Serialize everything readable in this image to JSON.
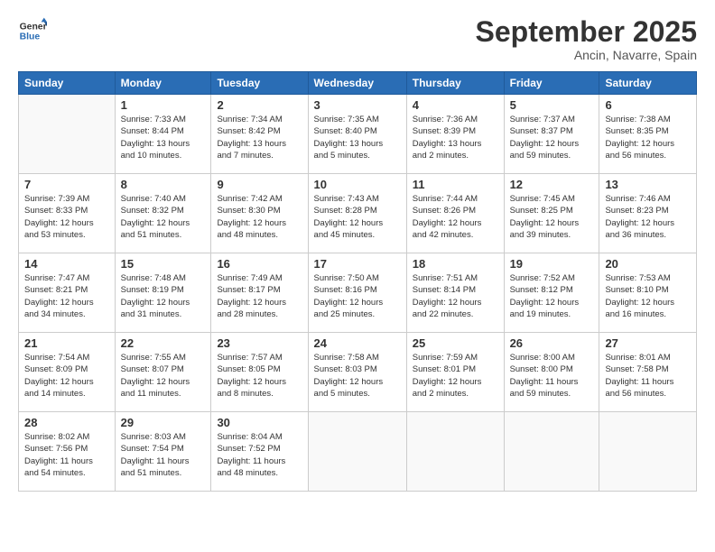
{
  "logo": {
    "line1": "General",
    "line2": "Blue"
  },
  "title": "September 2025",
  "subtitle": "Ancin, Navarre, Spain",
  "headers": [
    "Sunday",
    "Monday",
    "Tuesday",
    "Wednesday",
    "Thursday",
    "Friday",
    "Saturday"
  ],
  "weeks": [
    [
      {
        "day": "",
        "info": ""
      },
      {
        "day": "1",
        "info": "Sunrise: 7:33 AM\nSunset: 8:44 PM\nDaylight: 13 hours\nand 10 minutes."
      },
      {
        "day": "2",
        "info": "Sunrise: 7:34 AM\nSunset: 8:42 PM\nDaylight: 13 hours\nand 7 minutes."
      },
      {
        "day": "3",
        "info": "Sunrise: 7:35 AM\nSunset: 8:40 PM\nDaylight: 13 hours\nand 5 minutes."
      },
      {
        "day": "4",
        "info": "Sunrise: 7:36 AM\nSunset: 8:39 PM\nDaylight: 13 hours\nand 2 minutes."
      },
      {
        "day": "5",
        "info": "Sunrise: 7:37 AM\nSunset: 8:37 PM\nDaylight: 12 hours\nand 59 minutes."
      },
      {
        "day": "6",
        "info": "Sunrise: 7:38 AM\nSunset: 8:35 PM\nDaylight: 12 hours\nand 56 minutes."
      }
    ],
    [
      {
        "day": "7",
        "info": "Sunrise: 7:39 AM\nSunset: 8:33 PM\nDaylight: 12 hours\nand 53 minutes."
      },
      {
        "day": "8",
        "info": "Sunrise: 7:40 AM\nSunset: 8:32 PM\nDaylight: 12 hours\nand 51 minutes."
      },
      {
        "day": "9",
        "info": "Sunrise: 7:42 AM\nSunset: 8:30 PM\nDaylight: 12 hours\nand 48 minutes."
      },
      {
        "day": "10",
        "info": "Sunrise: 7:43 AM\nSunset: 8:28 PM\nDaylight: 12 hours\nand 45 minutes."
      },
      {
        "day": "11",
        "info": "Sunrise: 7:44 AM\nSunset: 8:26 PM\nDaylight: 12 hours\nand 42 minutes."
      },
      {
        "day": "12",
        "info": "Sunrise: 7:45 AM\nSunset: 8:25 PM\nDaylight: 12 hours\nand 39 minutes."
      },
      {
        "day": "13",
        "info": "Sunrise: 7:46 AM\nSunset: 8:23 PM\nDaylight: 12 hours\nand 36 minutes."
      }
    ],
    [
      {
        "day": "14",
        "info": "Sunrise: 7:47 AM\nSunset: 8:21 PM\nDaylight: 12 hours\nand 34 minutes."
      },
      {
        "day": "15",
        "info": "Sunrise: 7:48 AM\nSunset: 8:19 PM\nDaylight: 12 hours\nand 31 minutes."
      },
      {
        "day": "16",
        "info": "Sunrise: 7:49 AM\nSunset: 8:17 PM\nDaylight: 12 hours\nand 28 minutes."
      },
      {
        "day": "17",
        "info": "Sunrise: 7:50 AM\nSunset: 8:16 PM\nDaylight: 12 hours\nand 25 minutes."
      },
      {
        "day": "18",
        "info": "Sunrise: 7:51 AM\nSunset: 8:14 PM\nDaylight: 12 hours\nand 22 minutes."
      },
      {
        "day": "19",
        "info": "Sunrise: 7:52 AM\nSunset: 8:12 PM\nDaylight: 12 hours\nand 19 minutes."
      },
      {
        "day": "20",
        "info": "Sunrise: 7:53 AM\nSunset: 8:10 PM\nDaylight: 12 hours\nand 16 minutes."
      }
    ],
    [
      {
        "day": "21",
        "info": "Sunrise: 7:54 AM\nSunset: 8:09 PM\nDaylight: 12 hours\nand 14 minutes."
      },
      {
        "day": "22",
        "info": "Sunrise: 7:55 AM\nSunset: 8:07 PM\nDaylight: 12 hours\nand 11 minutes."
      },
      {
        "day": "23",
        "info": "Sunrise: 7:57 AM\nSunset: 8:05 PM\nDaylight: 12 hours\nand 8 minutes."
      },
      {
        "day": "24",
        "info": "Sunrise: 7:58 AM\nSunset: 8:03 PM\nDaylight: 12 hours\nand 5 minutes."
      },
      {
        "day": "25",
        "info": "Sunrise: 7:59 AM\nSunset: 8:01 PM\nDaylight: 12 hours\nand 2 minutes."
      },
      {
        "day": "26",
        "info": "Sunrise: 8:00 AM\nSunset: 8:00 PM\nDaylight: 11 hours\nand 59 minutes."
      },
      {
        "day": "27",
        "info": "Sunrise: 8:01 AM\nSunset: 7:58 PM\nDaylight: 11 hours\nand 56 minutes."
      }
    ],
    [
      {
        "day": "28",
        "info": "Sunrise: 8:02 AM\nSunset: 7:56 PM\nDaylight: 11 hours\nand 54 minutes."
      },
      {
        "day": "29",
        "info": "Sunrise: 8:03 AM\nSunset: 7:54 PM\nDaylight: 11 hours\nand 51 minutes."
      },
      {
        "day": "30",
        "info": "Sunrise: 8:04 AM\nSunset: 7:52 PM\nDaylight: 11 hours\nand 48 minutes."
      },
      {
        "day": "",
        "info": ""
      },
      {
        "day": "",
        "info": ""
      },
      {
        "day": "",
        "info": ""
      },
      {
        "day": "",
        "info": ""
      }
    ]
  ]
}
